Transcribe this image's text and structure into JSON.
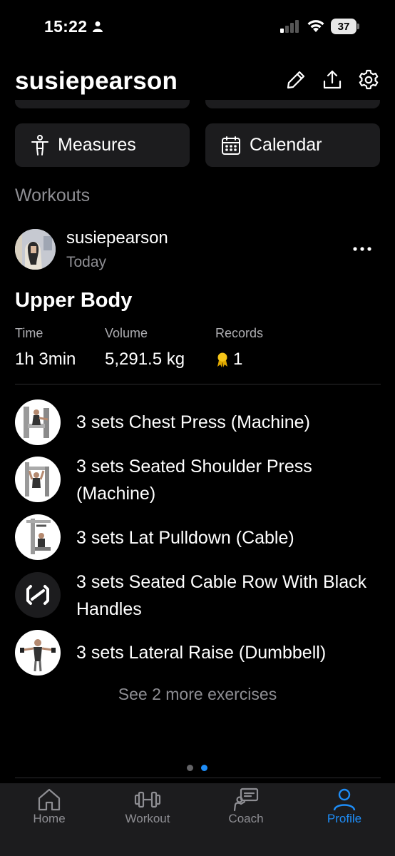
{
  "status_bar": {
    "time": "15:22",
    "battery": "37"
  },
  "header": {
    "username": "susiepearson"
  },
  "quick_actions": {
    "measures": "Measures",
    "calendar": "Calendar"
  },
  "workouts_section": {
    "title": "Workouts"
  },
  "post": {
    "user": "susiepearson",
    "date": "Today",
    "workout_title": "Upper Body",
    "stats": {
      "time_label": "Time",
      "time_value": "1h 3min",
      "volume_label": "Volume",
      "volume_value": "5,291.5 kg",
      "records_label": "Records",
      "records_value": "1"
    },
    "exercises": [
      {
        "name": "3 sets Chest Press (Machine)"
      },
      {
        "name": "3 sets Seated Shoulder Press (Machine)"
      },
      {
        "name": "3 sets Lat Pulldown (Cable)"
      },
      {
        "name": "3 sets Seated Cable Row With Black Handles"
      },
      {
        "name": "3 sets Lateral Raise (Dumbbell)"
      }
    ],
    "see_more": "See 2 more exercises"
  },
  "pagination": {
    "active_index": 1,
    "count": 2
  },
  "tab_bar": {
    "items": [
      {
        "label": "Home",
        "icon": "home-icon"
      },
      {
        "label": "Workout",
        "icon": "dumbbell-icon"
      },
      {
        "label": "Coach",
        "icon": "coach-icon"
      },
      {
        "label": "Profile",
        "icon": "profile-icon"
      }
    ],
    "active": "Profile"
  },
  "colors": {
    "accent": "#1e8df7",
    "card": "#1c1c1e",
    "muted": "#8e8e93",
    "medal": "#f5c518"
  }
}
